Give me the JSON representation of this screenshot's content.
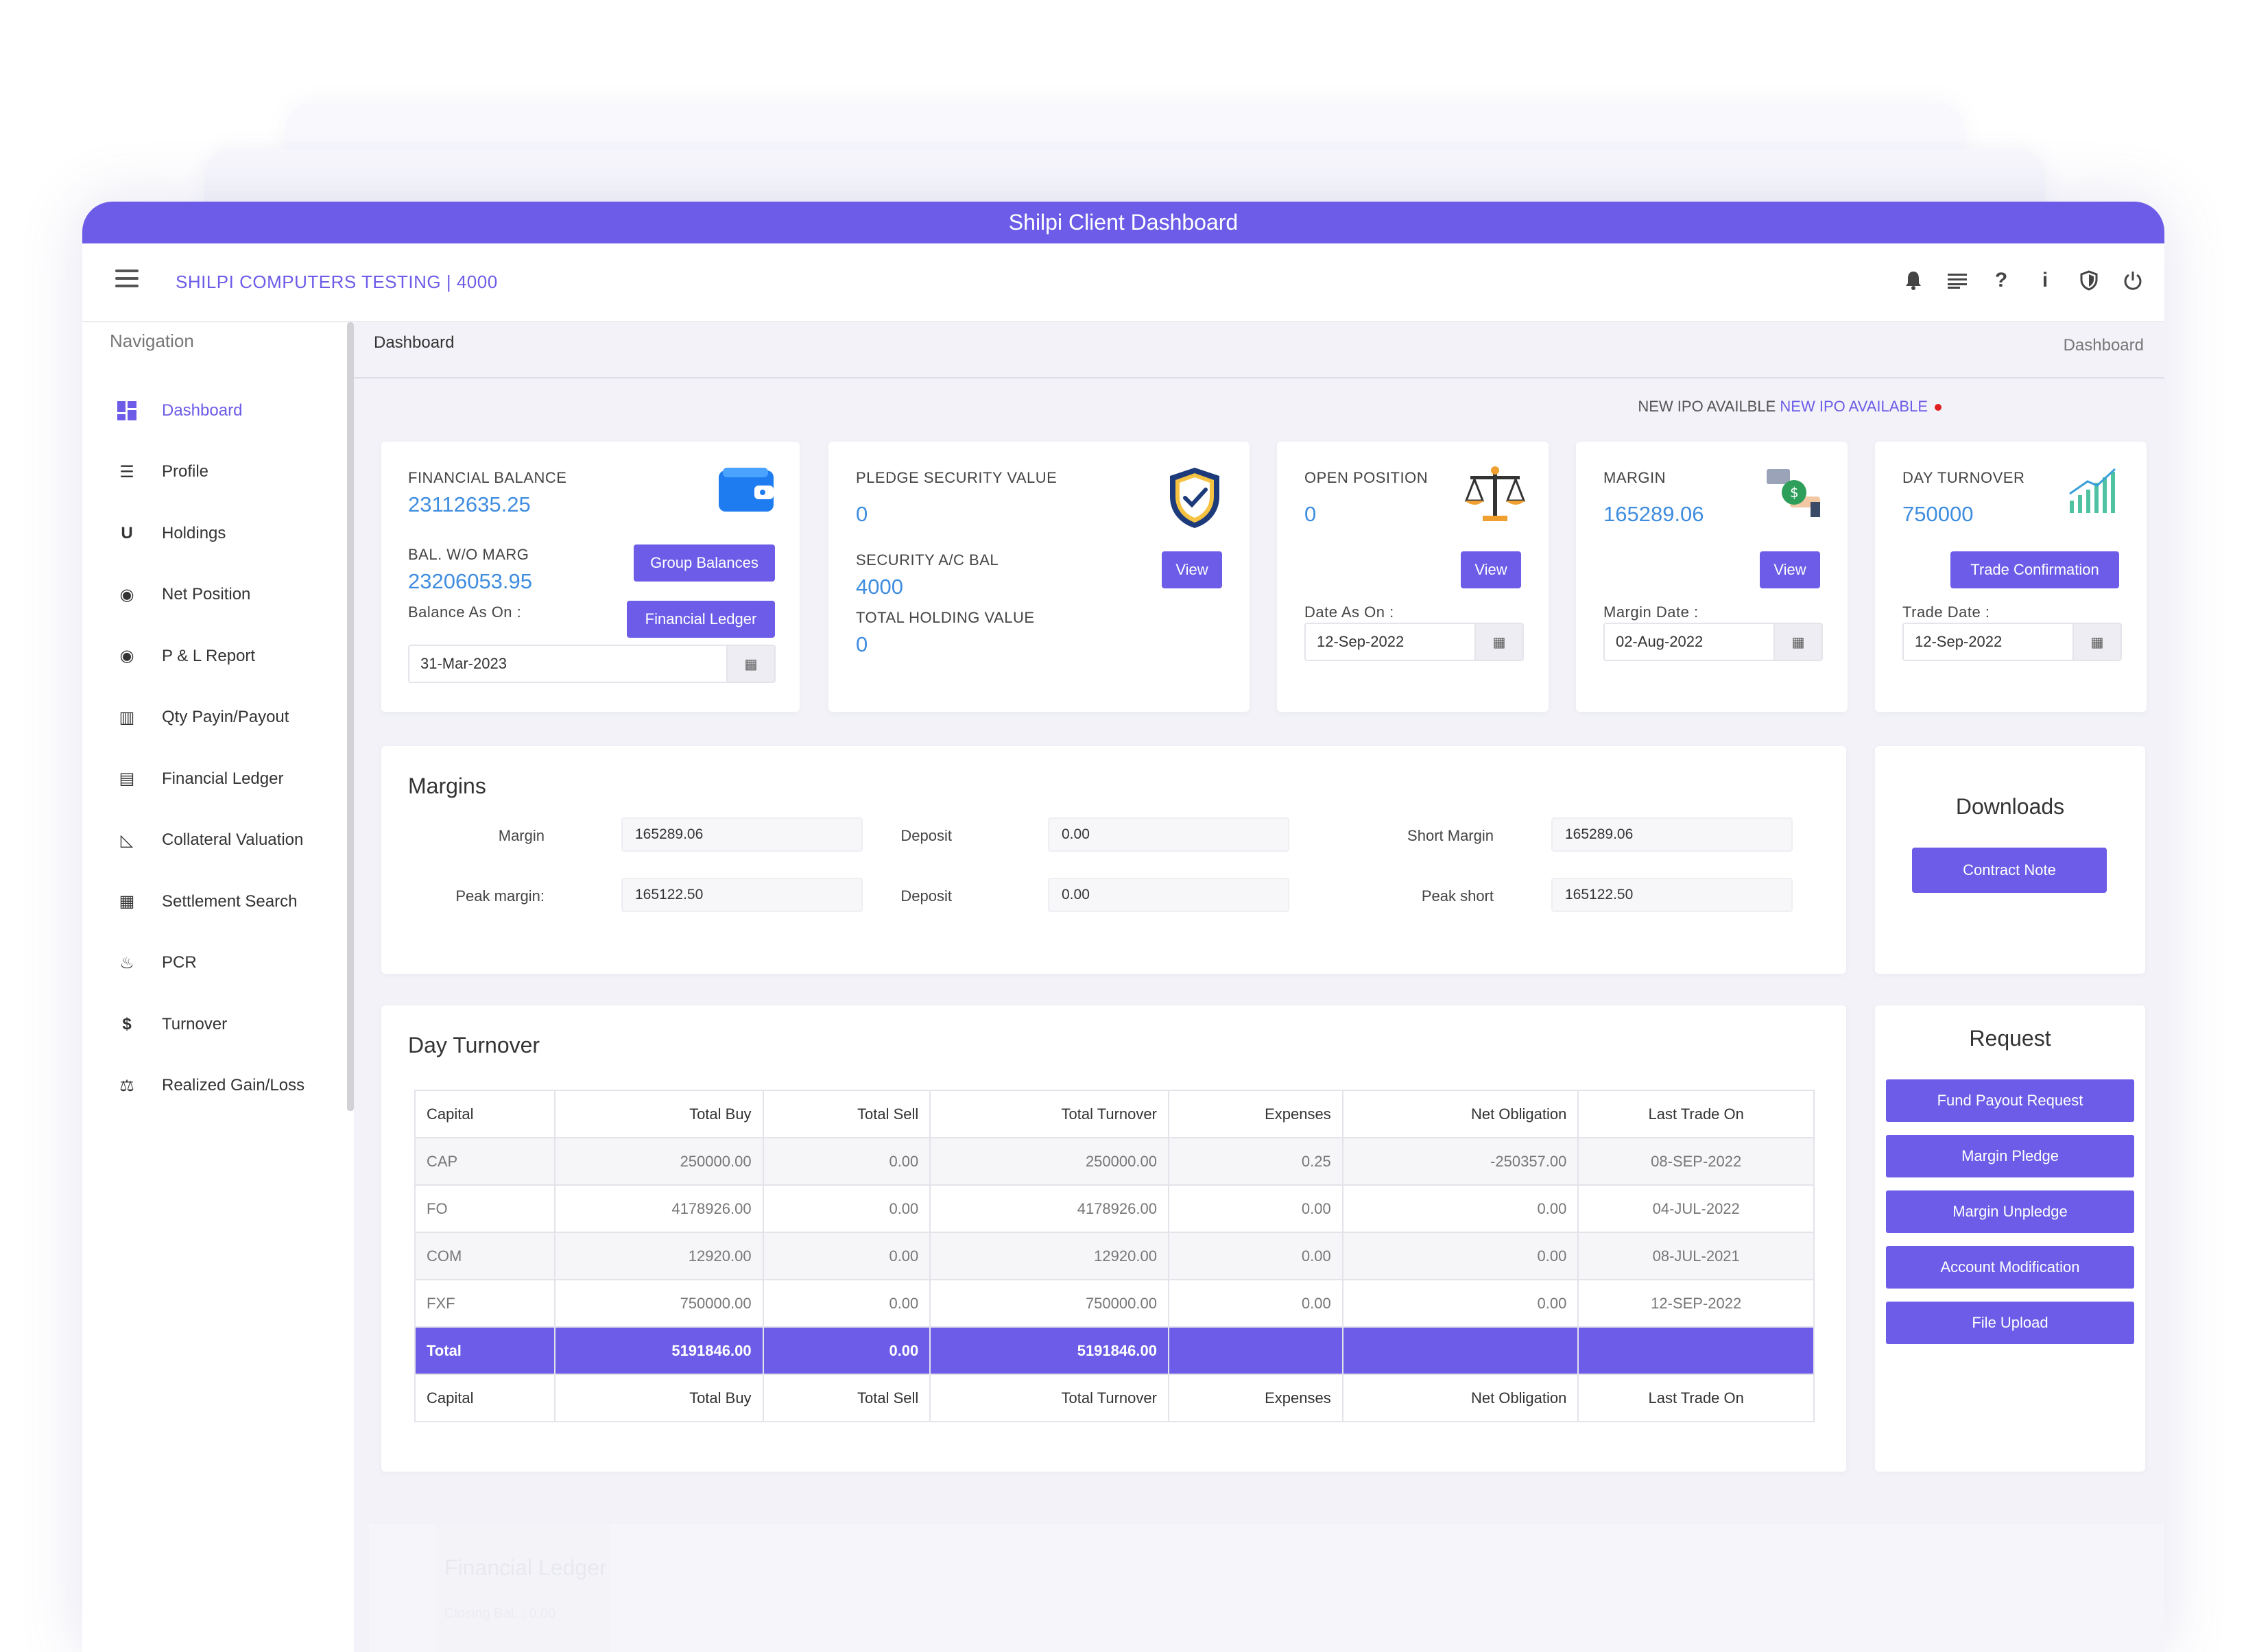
{
  "window_title": "Shilpi Client Dashboard",
  "company": "SHILPI COMPUTERS TESTING | 4000",
  "top_icons": [
    "bell-icon",
    "list-icon",
    "question-icon",
    "info-icon",
    "shield-icon",
    "power-icon"
  ],
  "nav": {
    "title": "Navigation",
    "items": [
      {
        "label": "Dashboard",
        "icon": "dashboard-icon",
        "glyph": "▦"
      },
      {
        "label": "Profile",
        "icon": "list-icon",
        "glyph": "☰"
      },
      {
        "label": "Holdings",
        "icon": "magnet-icon",
        "glyph": "U"
      },
      {
        "label": "Net Position",
        "icon": "disc-icon",
        "glyph": "◉"
      },
      {
        "label": "P & L Report",
        "icon": "disc-icon",
        "glyph": "◉"
      },
      {
        "label": "Qty Payin/Payout",
        "icon": "bar-chart-icon",
        "glyph": "▥"
      },
      {
        "label": "Financial Ledger",
        "icon": "book-icon",
        "glyph": "▤"
      },
      {
        "label": "Collateral Valuation",
        "icon": "area-chart-icon",
        "glyph": "◺"
      },
      {
        "label": "Settlement Search",
        "icon": "grid-icon",
        "glyph": "▦"
      },
      {
        "label": "PCR",
        "icon": "fire-icon",
        "glyph": "♨"
      },
      {
        "label": "Turnover",
        "icon": "dollar-icon",
        "glyph": "$"
      },
      {
        "label": "Realized Gain/Loss",
        "icon": "scale-icon",
        "glyph": "⚖"
      }
    ]
  },
  "breadcrumb": {
    "left": "Dashboard",
    "right": "Dashboard"
  },
  "ipo": {
    "text": "NEW IPO AVAILBLE",
    "link": "NEW IPO AVAILABLE"
  },
  "cards": {
    "financial": {
      "label": "FINANCIAL BALANCE",
      "value": "23112635.25",
      "bal_label": "BAL. W/O MARG",
      "bal_value": "23206053.95",
      "as_on_label": "Balance As On :",
      "date": "31-Mar-2023",
      "btn_group": "Group Balances",
      "btn_ledger": "Financial Ledger"
    },
    "pledge": {
      "label": "PLEDGE SECURITY VALUE",
      "value": "0",
      "sec_label": "SECURITY A/C BAL",
      "sec_value": "4000",
      "hold_label": "TOTAL HOLDING VALUE",
      "hold_value": "0",
      "btn": "View"
    },
    "open": {
      "label": "OPEN POSITION",
      "value": "0",
      "btn": "View",
      "date_label": "Date As On :",
      "date": "12-Sep-2022"
    },
    "margin": {
      "label": "MARGIN",
      "value": "165289.06",
      "btn": "View",
      "date_label": "Margin Date :",
      "date": "02-Aug-2022"
    },
    "turnover": {
      "label": "DAY TURNOVER",
      "value": "750000",
      "btn": "Trade Confirmation",
      "date_label": "Trade Date :",
      "date": "12-Sep-2022"
    }
  },
  "margins": {
    "title": "Margins",
    "rows": [
      [
        {
          "label": "Margin",
          "value": "165289.06"
        },
        {
          "label": "Deposit",
          "value": "0.00"
        },
        {
          "label": "Short Margin",
          "value": "165289.06"
        }
      ],
      [
        {
          "label": "Peak margin:",
          "value": "165122.50"
        },
        {
          "label": "Deposit",
          "value": "0.00"
        },
        {
          "label": "Peak short",
          "value": "165122.50"
        }
      ]
    ]
  },
  "downloads": {
    "title": "Downloads",
    "btn": "Contract Note"
  },
  "day_turnover": {
    "title": "Day Turnover",
    "columns": [
      "Capital",
      "Total Buy",
      "Total Sell",
      "Total Turnover",
      "Expenses",
      "Net Obligation",
      "Last Trade On"
    ],
    "rows": [
      [
        "CAP",
        "250000.00",
        "0.00",
        "250000.00",
        "0.25",
        "-250357.00",
        "08-SEP-2022"
      ],
      [
        "FO",
        "4178926.00",
        "0.00",
        "4178926.00",
        "0.00",
        "0.00",
        "04-JUL-2022"
      ],
      [
        "COM",
        "12920.00",
        "0.00",
        "12920.00",
        "0.00",
        "0.00",
        "08-JUL-2021"
      ],
      [
        "FXF",
        "750000.00",
        "0.00",
        "750000.00",
        "0.00",
        "0.00",
        "12-SEP-2022"
      ]
    ],
    "total": [
      "Total",
      "5191846.00",
      "0.00",
      "5191846.00",
      "",
      "",
      ""
    ]
  },
  "request": {
    "title": "Request",
    "buttons": [
      "Fund Payout Request",
      "Margin Pledge",
      "Margin Unpledge",
      "Account Modification",
      "File Upload"
    ]
  },
  "ghost": {
    "title": "Financial Ledger",
    "line": "Closing Bal. : 0.00"
  },
  "colors": {
    "accent": "#6c5ce7",
    "value_blue": "#3f8ddf"
  }
}
